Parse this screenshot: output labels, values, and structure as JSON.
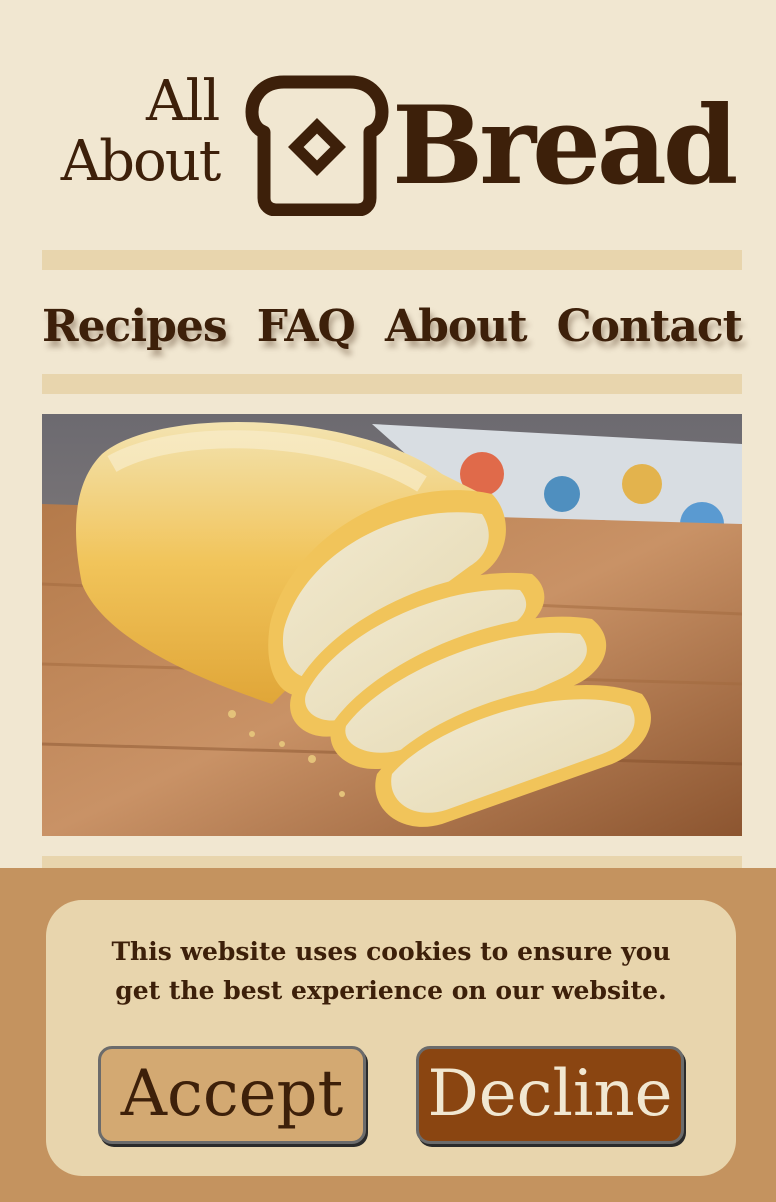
{
  "logo": {
    "line1": "All",
    "line2": "About",
    "big": "Bread",
    "icon": "bread-slice-icon"
  },
  "nav": {
    "items": [
      {
        "label": "Recipes"
      },
      {
        "label": "FAQ"
      },
      {
        "label": "About"
      },
      {
        "label": "Contact"
      }
    ]
  },
  "hero": {
    "image": "sliced-bread-loaf-photo"
  },
  "cookie": {
    "line1": "This website uses cookies to ensure you",
    "line2": "get the best experience on our website.",
    "accept_label": "Accept",
    "decline_label": "Decline"
  },
  "colors": {
    "background": "#f1e7d1",
    "band": "#e8d5ad",
    "text": "#3d200a",
    "cookie_bar": "#c4935f",
    "accept": "#d3a972",
    "decline": "#8a4511"
  }
}
